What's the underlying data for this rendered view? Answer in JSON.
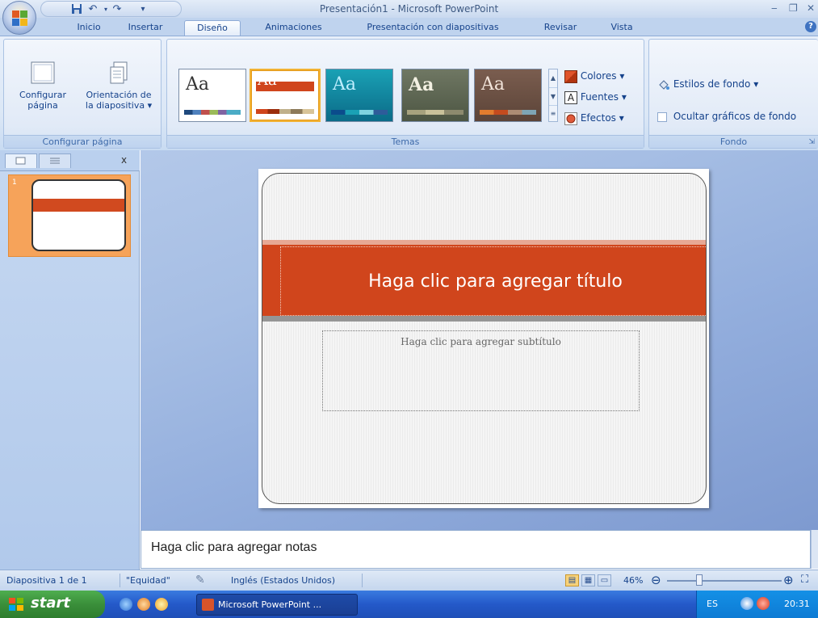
{
  "window": {
    "title": "Presentación1 - Microsoft PowerPoint"
  },
  "tabs": [
    {
      "label": "Inicio"
    },
    {
      "label": "Insertar"
    },
    {
      "label": "Diseño"
    },
    {
      "label": "Animaciones"
    },
    {
      "label": "Presentación con diapositivas"
    },
    {
      "label": "Revisar"
    },
    {
      "label": "Vista"
    }
  ],
  "ribbon": {
    "page_setup": {
      "group_label": "Configurar página",
      "configure_line1": "Configurar",
      "configure_line2": "página",
      "orientation_line1": "Orientación de",
      "orientation_line2": "la diapositiva ▾"
    },
    "themes": {
      "group_label": "Temas",
      "sample_text": "Aa",
      "colors": "Colores ▾",
      "fonts": "Fuentes ▾",
      "effects": "Efectos ▾",
      "fonts_icon_letter": "A"
    },
    "background": {
      "group_label": "Fondo",
      "styles": "Estilos de fondo ▾",
      "hide_graphics": "Ocultar gráficos de fondo"
    }
  },
  "pane": {
    "close": "x",
    "slide_number": "1"
  },
  "slide": {
    "title_placeholder": "Haga clic para agregar título",
    "subtitle_placeholder": "Haga clic para agregar subtítulo"
  },
  "notes": {
    "placeholder": "Haga clic para agregar notas"
  },
  "status": {
    "slide_of": "Diapositiva 1 de 1",
    "theme": "\"Equidad\"",
    "language": "Inglés (Estados Unidos)",
    "zoom": "46%"
  },
  "taskbar": {
    "start": "start",
    "task": "Microsoft PowerPoint ...",
    "lang": "ES",
    "time": "20:31"
  },
  "colors": {
    "accent": "#d0451c",
    "ribbon_blue": "#15428b"
  }
}
